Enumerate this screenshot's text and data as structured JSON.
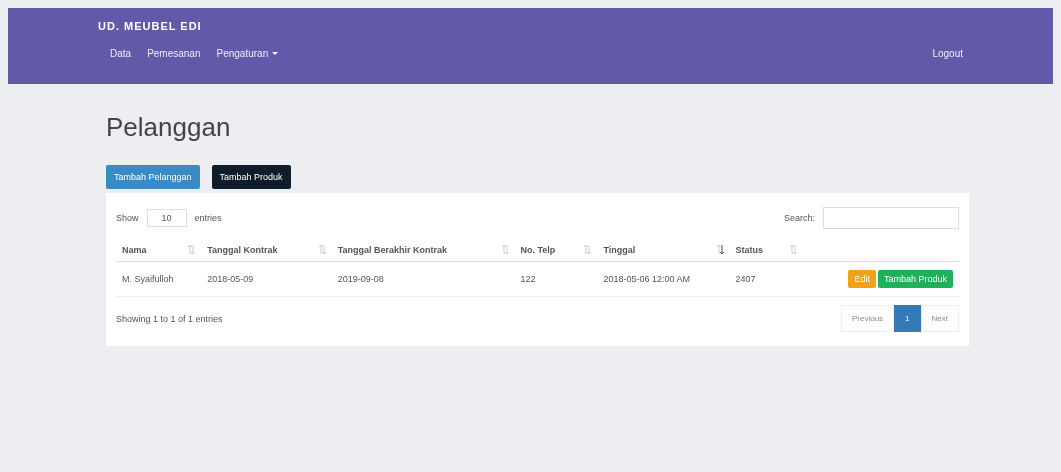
{
  "navbar": {
    "brand": "UD. MEUBEL EDI",
    "menu": [
      {
        "label": "Data",
        "dropdown": false
      },
      {
        "label": "Pemesanan",
        "dropdown": false
      },
      {
        "label": "Pengaturan",
        "dropdown": true
      }
    ],
    "logout": "Logout"
  },
  "page_title": "Pelanggan",
  "actions": [
    {
      "label": "Tambah Pelanggan",
      "kind": "primary"
    },
    {
      "label": "Tambah Produk",
      "kind": "dark"
    }
  ],
  "length": {
    "show": "Show",
    "value": "10",
    "entries": "entries"
  },
  "search": {
    "label": "Search:"
  },
  "table": {
    "columns": [
      {
        "label": "Nama",
        "sorted": false
      },
      {
        "label": "Tanggal Kontrak",
        "sorted": false
      },
      {
        "label": "Tanggal Berakhir Kontrak",
        "sorted": false
      },
      {
        "label": "No. Telp",
        "sorted": false
      },
      {
        "label": "Tinggal",
        "sorted": true
      },
      {
        "label": "Status",
        "sorted": false
      }
    ],
    "rows": [
      {
        "cells": [
          "M. Syaifulloh",
          "2018-05-09",
          "2019-09-08",
          "122",
          "2018-05-06 12:00 AM",
          "2407"
        ],
        "buttons": [
          {
            "label": "Edit",
            "kind": "warning"
          },
          {
            "label": "Tambah Produk",
            "kind": "success"
          }
        ]
      }
    ]
  },
  "info": "Showing 1 to 1 of 1 entries",
  "pagination": [
    {
      "label": "Previous",
      "selected": false
    },
    {
      "label": "1",
      "selected": true
    },
    {
      "label": "Next",
      "selected": false
    }
  ]
}
